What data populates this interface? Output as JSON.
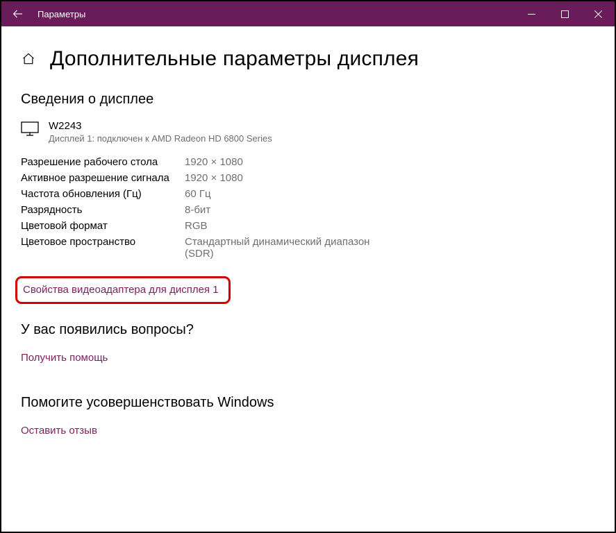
{
  "window": {
    "title": "Параметры"
  },
  "page": {
    "title": "Дополнительные параметры дисплея"
  },
  "display_info": {
    "section_title": "Сведения о дисплее",
    "monitor_name": "W2243",
    "monitor_sub": "Дисплей 1: подключен к AMD Radeon HD 6800 Series",
    "rows": [
      {
        "key": "Разрешение рабочего стола",
        "val": "1920 × 1080"
      },
      {
        "key": "Активное разрешение сигнала",
        "val": "1920 × 1080"
      },
      {
        "key": "Частота обновления (Гц)",
        "val": "60 Гц"
      },
      {
        "key": "Разрядность",
        "val": "8-бит"
      },
      {
        "key": "Цветовой формат",
        "val": "RGB"
      },
      {
        "key": "Цветовое пространство",
        "val": "Стандартный динамический диапазон (SDR)"
      }
    ],
    "adapter_props_link": "Свойства видеоадаптера для дисплея 1"
  },
  "help": {
    "section_title": "У вас появились вопросы?",
    "link": "Получить помощь"
  },
  "feedback": {
    "section_title": "Помогите усовершенствовать Windows",
    "link": "Оставить отзыв"
  }
}
